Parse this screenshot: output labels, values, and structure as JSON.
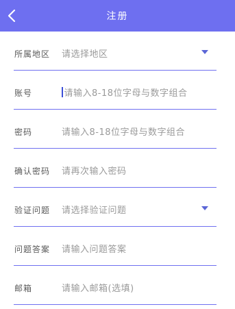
{
  "colors": {
    "header_bg": "#6e6ff0",
    "divider": "#6e6ff0",
    "dropdown_arrow": "#5b66d6",
    "placeholder_text": "#9a9a9a",
    "label_text": "#5a5a5a"
  },
  "header": {
    "title": "注册",
    "back_icon": "chevron-left-icon"
  },
  "form": {
    "region": {
      "label": "所属地区",
      "placeholder": "请选择地区"
    },
    "account": {
      "label": "账号",
      "placeholder": "请输入8-18位字母与数字组合"
    },
    "password": {
      "label": "密码",
      "placeholder": "请输入8-18位字母与数字组合"
    },
    "confirm_password": {
      "label": "确认密码",
      "placeholder": "请再次输入密码"
    },
    "security_question": {
      "label": "验证问题",
      "placeholder": "请选择验证问题"
    },
    "answer": {
      "label": "问题答案",
      "placeholder": "请输入问题答案"
    },
    "email": {
      "label": "邮箱",
      "placeholder": "请输入邮箱(选填)"
    }
  }
}
